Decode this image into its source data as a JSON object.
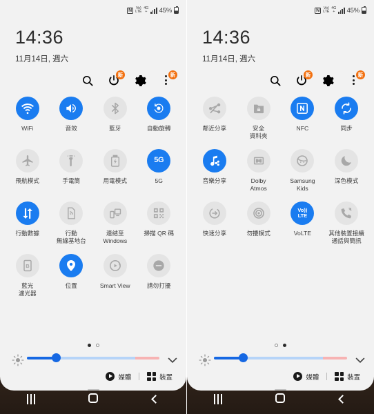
{
  "meta": {
    "screen_kind": "android-quick-settings-panel",
    "panels": 2,
    "accent_on": "#1a7cf0",
    "tile_off_bg": "#e4e4e4",
    "badge_color": "#f2700f",
    "panel_bg": "#f2f2f2",
    "navbar_bg": "#2a1e18"
  },
  "statusbar": {
    "nfc_glyph": "N",
    "network_top": "Vo)",
    "network_bottom": "LTE",
    "network2_top": "4G",
    "network2_bottom": "+",
    "battery_percent": "45%"
  },
  "header": {
    "time": "14:36",
    "date": "11月14日, 週六",
    "icons": [
      {
        "name": "search-icon",
        "badge": ""
      },
      {
        "name": "power-icon",
        "badge": "新"
      },
      {
        "name": "settings-gear-icon",
        "badge": ""
      },
      {
        "name": "more-options-icon",
        "badge": "新"
      }
    ]
  },
  "panel_left": {
    "page_index": 0,
    "tiles": [
      {
        "label": "WiFi",
        "icon": "wifi-icon",
        "on": true
      },
      {
        "label": "音效",
        "icon": "sound-icon",
        "on": true
      },
      {
        "label": "藍牙",
        "icon": "bluetooth-icon",
        "on": false
      },
      {
        "label": "自動旋轉",
        "icon": "auto-rotate-icon",
        "on": true
      },
      {
        "label": "飛航模式",
        "icon": "airplane-icon",
        "on": false
      },
      {
        "label": "手電筒",
        "icon": "flashlight-icon",
        "on": false
      },
      {
        "label": "用電模式",
        "icon": "power-mode-icon",
        "on": false
      },
      {
        "label": "5G",
        "icon": "five-g-icon",
        "on": true
      },
      {
        "label": "行動數據",
        "icon": "mobile-data-icon",
        "on": true
      },
      {
        "label": "行動\n無線基地台",
        "icon": "mobile-hotspot-icon",
        "on": false
      },
      {
        "label": "連結至\nWindows",
        "icon": "link-to-windows-icon",
        "on": false
      },
      {
        "label": "掃描 QR 碼",
        "icon": "qr-scan-icon",
        "on": false
      },
      {
        "label": "藍光\n濾光器",
        "icon": "blue-light-filter-icon",
        "on": false
      },
      {
        "label": "位置",
        "icon": "location-pin-icon",
        "on": true
      },
      {
        "label": "Smart View",
        "icon": "smart-view-icon",
        "on": false
      },
      {
        "label": "請勿打擾",
        "icon": "do-not-disturb-icon",
        "on": false
      }
    ],
    "brightness": {
      "value_percent": 22
    },
    "footer": {
      "media_label": "媒體",
      "devices_label": "裝置"
    }
  },
  "panel_right": {
    "page_index": 1,
    "tiles": [
      {
        "label": "鄰近分享",
        "icon": "nearby-share-off-icon",
        "on": false
      },
      {
        "label": "安全\n資料夾",
        "icon": "secure-folder-icon",
        "on": false
      },
      {
        "label": "NFC",
        "icon": "nfc-icon",
        "on": true
      },
      {
        "label": "同步",
        "icon": "sync-icon",
        "on": true
      },
      {
        "label": "音樂分享",
        "icon": "music-share-icon",
        "on": true
      },
      {
        "label": "Dolby\nAtmos",
        "icon": "dolby-atmos-icon",
        "on": false
      },
      {
        "label": "Samsung\nKids",
        "icon": "samsung-kids-icon",
        "on": false
      },
      {
        "label": "深色模式",
        "icon": "dark-mode-icon",
        "on": false
      },
      {
        "label": "快速分享",
        "icon": "quick-share-icon",
        "on": false
      },
      {
        "label": "勿擾模式",
        "icon": "dnd-mode-icon",
        "on": false
      },
      {
        "label": "VoLTE",
        "icon": "volte-icon",
        "on": true
      },
      {
        "label": "其他裝置接續\n通話與簡訊",
        "icon": "call-continuity-icon",
        "on": false
      }
    ],
    "brightness": {
      "value_percent": 22
    },
    "footer": {
      "media_label": "媒體",
      "devices_label": "裝置"
    }
  },
  "navbar": {
    "recents_label": "recents",
    "home_label": "home",
    "back_label": "back"
  }
}
